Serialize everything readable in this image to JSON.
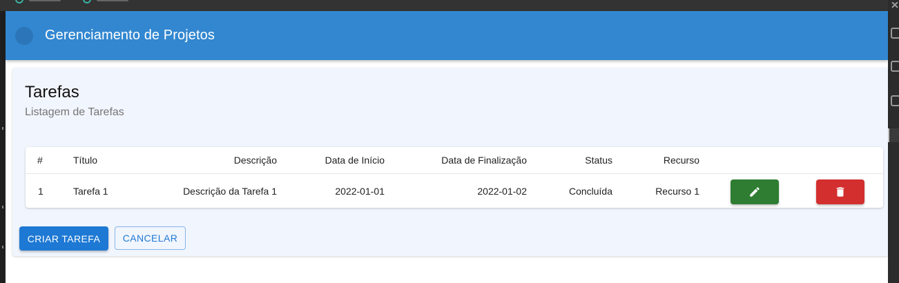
{
  "app_bar": {
    "title": "Gerenciamento de Projetos",
    "color": "#3287d0"
  },
  "page": {
    "title": "Tarefas",
    "subtitle": "Listagem de Tarefas"
  },
  "table": {
    "columns": [
      "#",
      "Título",
      "Descrição",
      "Data de Início",
      "Data de Finalização",
      "Status",
      "Recurso"
    ],
    "rows": [
      {
        "id": "1",
        "titulo": "Tarefa 1",
        "descricao": "Descrição da Tarefa 1",
        "data_inicio": "2022-01-01",
        "data_finalizacao": "2022-01-02",
        "status": "Concluída",
        "recurso": "Recurso 1",
        "edit_icon": "pencil-icon",
        "delete_icon": "trash-icon"
      }
    ]
  },
  "actions": {
    "create_label": "CRIAR TAREFA",
    "cancel_label": "CANCELAR"
  },
  "colors": {
    "primary": "#1e79d4",
    "edit": "#2e7d32",
    "delete": "#d32f2f",
    "card_background": "#f1f5fd"
  }
}
